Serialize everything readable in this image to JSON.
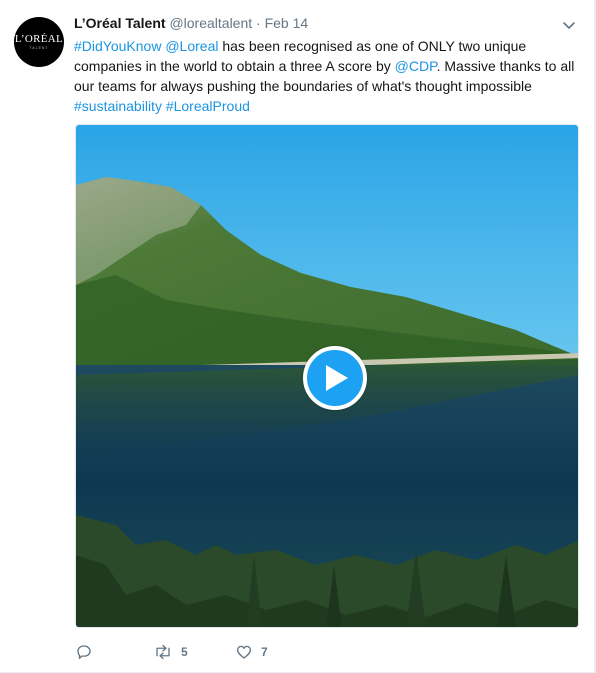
{
  "tweet": {
    "author": {
      "name": "L’Oréal Talent",
      "handle": "@lorealtalent",
      "avatar_brand": "L’ORÉAL",
      "avatar_sub": "TALENT"
    },
    "separator": "·",
    "timestamp": "Feb 14",
    "text": {
      "hashtag_1": "#DidYouKnow",
      "mention_1": "@Loreal",
      "part_1": " has been recognised as one of ONLY two unique companies in the world to obtain a three A score by ",
      "mention_2": "@CDP",
      "part_2": ". Massive thanks to all our teams for always pushing the boundaries of what's thought impossible",
      "hashtag_2": "#sustainability",
      "hashtag_3": "#LorealProud"
    },
    "media": {
      "type": "video"
    },
    "actions": {
      "reply_count": "",
      "retweet_count": "5",
      "like_count": "7"
    }
  },
  "colors": {
    "link": "#1b95e0",
    "play_button": "#1da1f2",
    "secondary_text": "#657786"
  },
  "icons": [
    "chevron-down-icon",
    "play-icon",
    "reply-icon",
    "retweet-icon",
    "like-icon"
  ]
}
